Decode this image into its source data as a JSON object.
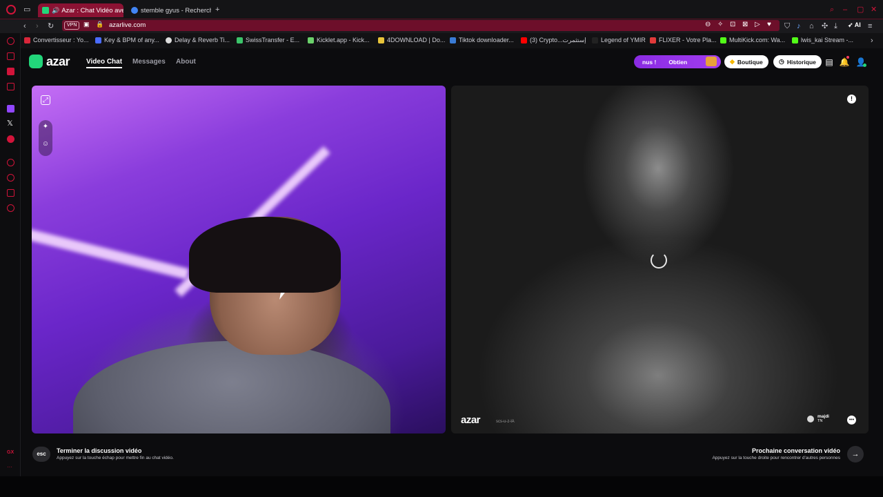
{
  "browser": {
    "tabs": [
      {
        "title": "Azar : Chat Vidéo avec",
        "active": true
      },
      {
        "title": "stemble gyus - Recherche",
        "active": false
      }
    ],
    "new_tab": "+",
    "vpn_label": "VPN",
    "url": "azarlive.com",
    "ai_label": "AI",
    "bookmarks": [
      "Convertisseur : Yo...",
      "Key & BPM of any...",
      "Delay & Reverb Ti...",
      "SwissTransfer - E...",
      "Kicklet.app - Kick...",
      "4DOWNLOAD | Do...",
      "Tiktok downloader...",
      "(3) Crypto...إستثمرت",
      "Legend of YMIR",
      "FLIXER - Votre Pla...",
      "MultiKick.com: Wa...",
      "lwis_kai Stream -..."
    ],
    "sidebar_gx_label": "GX",
    "sidebar_more": "···"
  },
  "app": {
    "logo_text": "azar",
    "nav": [
      {
        "label": "Video Chat",
        "active": true
      },
      {
        "label": "Messages",
        "active": false
      },
      {
        "label": "About",
        "active": false
      }
    ],
    "promo": {
      "left": "nus !",
      "right": "Obtien"
    },
    "shop_button": "Boutique",
    "history_button": "Historique"
  },
  "remote": {
    "watermark": "azar",
    "watermark_code": "scs-u-z-lA",
    "user_name": "majdi",
    "user_country": "TN"
  },
  "actions": {
    "esc_key": "esc",
    "end_title": "Terminer la discussion vidéo",
    "end_hint": "Appuyez sur la touche échap pour mettre fin au chat vidéo.",
    "next_title": "Prochaine conversation vidéo",
    "next_hint": "Appuyez sur la touche droite pour rencontrer d'autres personnes"
  },
  "colors": {
    "accent_green": "#22d67a",
    "opera_red": "#8b1233",
    "promo_purple": "#8a2be2"
  },
  "icons": [
    "opera-icon",
    "tab-manager-icon",
    "mute-icon",
    "back-icon",
    "forward-icon",
    "reload-icon",
    "camera-icon",
    "lock-icon",
    "zoom-icon",
    "pin-icon",
    "screenshot-icon",
    "shield-icon",
    "heart-icon",
    "extensions-icon",
    "download-icon",
    "settings-icon",
    "gem-icon",
    "clock-icon",
    "store-icon",
    "bell-icon",
    "user-icon",
    "filter-icon",
    "magic-wand-icon",
    "sticker-icon",
    "report-icon",
    "chat-icon",
    "arrow-right-icon"
  ]
}
